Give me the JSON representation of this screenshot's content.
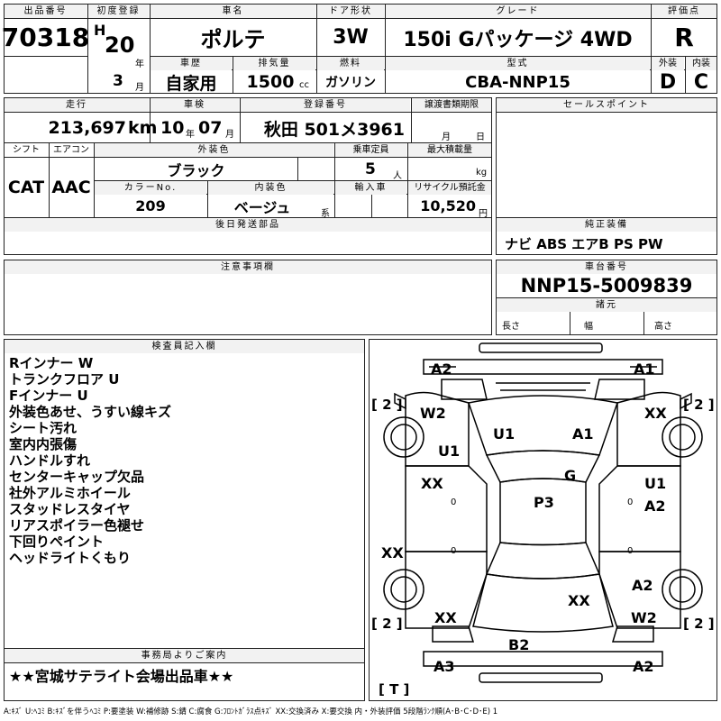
{
  "header": {
    "lot_no_label": "出品番号",
    "lot_no": "70318",
    "first_reg_label": "初度登録",
    "era": "H",
    "year": "20",
    "year_unit": "年",
    "month": "3",
    "month_unit": "月",
    "car_name_label": "車名",
    "car_name": "ポルテ",
    "door_label": "ドア形状",
    "door": "3W",
    "grade_label": "グレード",
    "grade": "150i Gパッケージ 4WD",
    "score_label": "評価点",
    "score": "R",
    "history_label": "車歴",
    "history": "自家用",
    "displacement_label": "排気量",
    "displacement": "1500",
    "displacement_unit": "cc",
    "fuel_label": "燃料",
    "fuel": "ガソリン",
    "model_label": "型式",
    "model": "CBA-NNP15",
    "exterior_label": "外装",
    "exterior": "D",
    "interior_label": "内装",
    "interior": "C"
  },
  "row2": {
    "mileage_label": "走行",
    "mileage": "213,697",
    "mileage_unit": "km",
    "inspection_label": "車検",
    "inspection_year": "10",
    "inspection_year_unit": "年",
    "inspection_month": "07",
    "inspection_month_unit": "月",
    "plate_label": "登録番号",
    "plate": "秋田 501メ3961",
    "transfer_label": "譲渡書類期限",
    "transfer_month_unit": "月",
    "transfer_day_unit": "日",
    "shift_label": "シフト",
    "shift": "CAT",
    "ac_label": "エアコン",
    "ac": "AAC",
    "color_label": "外装色",
    "color": "ブラック",
    "capacity_label": "乗車定員",
    "capacity": "5",
    "capacity_unit": "人",
    "load_label": "最大積載量",
    "load_unit": "kg",
    "color_no_label": "カラーNo.",
    "color_no": "209",
    "interior_color_label": "内装色",
    "interior_color": "ベージュ",
    "interior_color_unit": "系",
    "import_label": "輸入車",
    "recycle_label": "リサイクル預託金",
    "recycle": "10,520",
    "recycle_unit": "円",
    "later_parts_label": "後日発送部品",
    "sales_point_label": "セールスポイント",
    "equipment_label": "純正装備",
    "equipment": "ナビ ABS エアB PS PW"
  },
  "notes_section": {
    "label": "注意事項欄",
    "chassis_label": "車台番号",
    "chassis": "NNP15-5009839",
    "specs_label": "諸元",
    "length_label": "長さ",
    "width_label": "幅",
    "height_label": "高さ"
  },
  "inspector": {
    "label": "検査員記入欄",
    "notes": [
      "Rインナー W",
      "トランクフロア U",
      "Fインナー U",
      "外装色あせ、うすい線キズ",
      "シート汚れ",
      "室内内張傷",
      "ハンドルすれ",
      "センターキャップ欠品",
      "社外アルミホイール",
      "スタッドレスタイヤ",
      "リアスポイラー色褪せ",
      "下回りペイント",
      "ヘッドライトくもり"
    ]
  },
  "office": {
    "label": "事務局よりご案内",
    "message": "★★宮城サテライト会場出品車★★"
  },
  "diagram": {
    "labels": {
      "a2_top": "A2",
      "a1_top": "A1",
      "w2_left": "W2",
      "xx_right_top": "XX",
      "u1_hood": "U1",
      "a1_hood": "A1",
      "u1_left": "U1",
      "g_mid": "G",
      "xx_left_door": "XX",
      "u1_right": "U1",
      "a2_right": "A2",
      "p3_roof": "P3",
      "xx_left_side": "XX",
      "a2_right_rear": "A2",
      "xx_center_rear": "XX",
      "xx_left_rear": "XX",
      "w2_right_rear": "W2",
      "b2_rear": "B2",
      "a3_bottom": "A3",
      "a2_bottom": "A2"
    },
    "tire_left_front": "[ 2 ]",
    "tire_right_front": "[ 2 ]",
    "tire_left_rear": "[ 2 ]",
    "tire_right_rear": "[ 2 ]",
    "spare": "[ T ]",
    "zero": "0"
  },
  "legend": "A:ｷｽﾞ U:ﾍｺﾐ B:ｷｽﾞを伴うﾍｺﾐ P:要塗装 W:補修跡 S:錆 C:腐食 G:ﾌﾛﾝﾄｶﾞﾗｽ点ｷｽﾞ XX:交換済み X:要交換 内・外装評価 5段階ﾗﾝｸ順(A･B･C･D･E) 1"
}
